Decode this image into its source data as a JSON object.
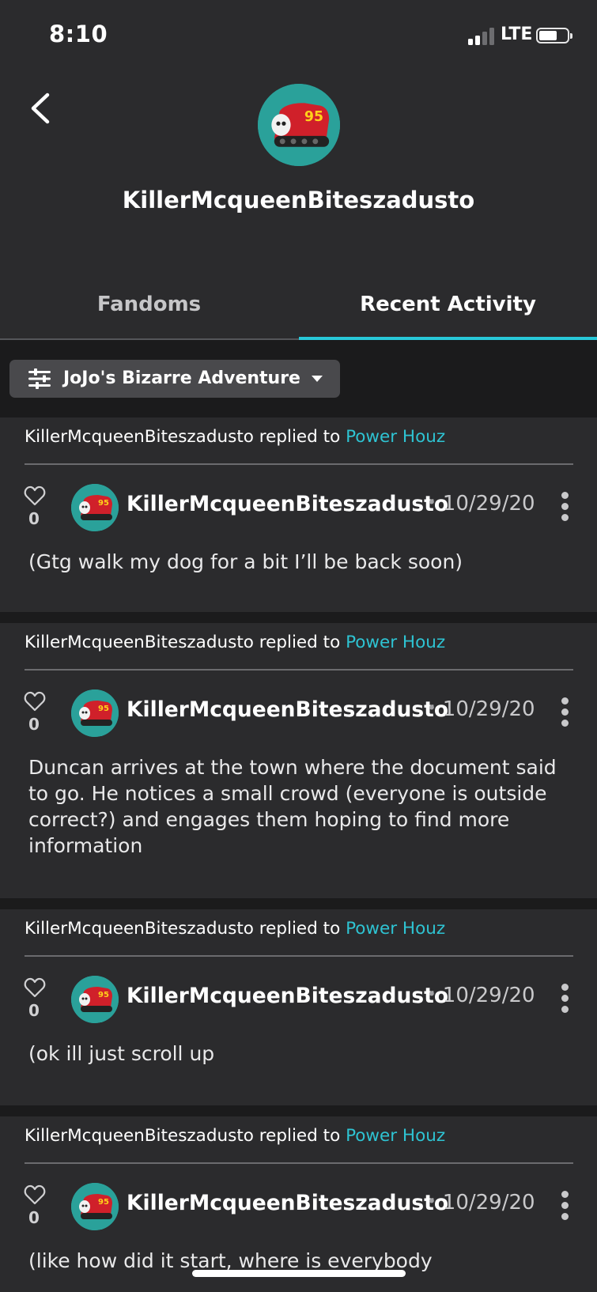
{
  "status_bar": {
    "time": "8:10",
    "network": "LTE",
    "signal_bars": 2,
    "signal_bars_total": 4
  },
  "header": {
    "back_icon": "chevron-left-icon",
    "username": "KillerMcqueenBiteszadusto",
    "avatar_badge": "95"
  },
  "tabs": [
    {
      "label": "Fandoms",
      "active": false
    },
    {
      "label": "Recent Activity",
      "active": true
    }
  ],
  "filter": {
    "label": "JoJo's Bizarre Adventure",
    "icon": "sliders-icon"
  },
  "colors": {
    "accent": "#28c8d8",
    "link": "#2ec3d2",
    "background": "#2b2b2d",
    "separator": "#1b1b1c",
    "avatar_bg": "#2aa19a"
  },
  "posts": [
    {
      "replied_prefix": "KillerMcqueenBiteszadusto replied to",
      "replied_target": "Power Houz",
      "likes": "0",
      "author": "KillerMcqueenBiteszadusto",
      "date": "10/29/20",
      "text": "(Gtg walk my dog for a bit I’ll be back soon)"
    },
    {
      "replied_prefix": "KillerMcqueenBiteszadusto replied to",
      "replied_target": "Power Houz",
      "likes": "0",
      "author": "KillerMcqueenBiteszadusto",
      "date": "10/29/20",
      "text": "Duncan arrives at the town where the document said to go. He notices a small crowd (everyone is outside correct?) and engages them hoping to find more information"
    },
    {
      "replied_prefix": "KillerMcqueenBiteszadusto replied to",
      "replied_target": "Power Houz",
      "likes": "0",
      "author": "KillerMcqueenBiteszadusto",
      "date": "10/29/20",
      "text": "(ok ill just scroll up"
    },
    {
      "replied_prefix": "KillerMcqueenBiteszadusto replied to",
      "replied_target": "Power Houz",
      "likes": "0",
      "author": "KillerMcqueenBiteszadusto",
      "date": "10/29/20",
      "text": "(like how did it start, where is everybody"
    }
  ]
}
